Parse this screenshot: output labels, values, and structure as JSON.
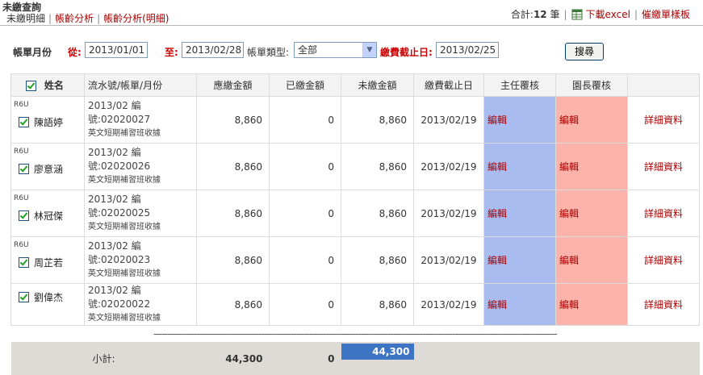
{
  "header": {
    "title": "未繳查詢",
    "nav": [
      "未繳明細",
      "帳齡分析",
      "帳齡分析(明細)"
    ],
    "total_prefix": "合計:",
    "total_count": "12",
    "total_suffix": "筆",
    "download_excel": "下載excel",
    "collection_sample": "催繳單樣板"
  },
  "filter": {
    "label": "帳單月份",
    "from_label": "從:",
    "from_value": "2013/01/01",
    "to_label": "至:",
    "to_value": "2013/02/28",
    "type_label": "帳單類型:",
    "type_value": "全部",
    "deadline_label": "繳費截止日:",
    "deadline_value": "2013/02/25",
    "search_button": "搜尋"
  },
  "table": {
    "headers": [
      "姓名",
      "流水號/帳單/月份",
      "應繳金額",
      "已繳金額",
      "未繳金額",
      "繳費截止日",
      "主任覆核",
      "園長覆核",
      ""
    ],
    "rows": [
      {
        "code": "R6U",
        "name": "陳語婷",
        "line1": "2013/02 編號:02020027",
        "line2": "英文短期補習班收據",
        "due": "8,860",
        "paid": "0",
        "unpaid": "8,860",
        "deadline": "2013/02/19",
        "edit1": "編輯",
        "edit2": "編輯",
        "detail": "詳細資料"
      },
      {
        "code": "R6U",
        "name": "廖意涵",
        "line1": "2013/02 編號:02020026",
        "line2": "英文短期補習班收據",
        "due": "8,860",
        "paid": "0",
        "unpaid": "8,860",
        "deadline": "2013/02/19",
        "edit1": "編輯",
        "edit2": "編輯",
        "detail": "詳細資料"
      },
      {
        "code": "R6U",
        "name": "林冠傑",
        "line1": "2013/02 編號:02020025",
        "line2": "英文短期補習班收據",
        "due": "8,860",
        "paid": "0",
        "unpaid": "8,860",
        "deadline": "2013/02/19",
        "edit1": "編輯",
        "edit2": "編輯",
        "detail": "詳細資料"
      },
      {
        "code": "R6U",
        "name": "周芷若",
        "line1": "2013/02 編號:02020023",
        "line2": "英文短期補習班收據",
        "due": "8,860",
        "paid": "0",
        "unpaid": "8,860",
        "deadline": "2013/02/19",
        "edit1": "編輯",
        "edit2": "編輯",
        "detail": "詳細資料"
      },
      {
        "code": "",
        "name": "劉偉杰",
        "line1": "2013/02 編號:02020022",
        "line2": "英文短期補習班收據",
        "due": "8,860",
        "paid": "0",
        "unpaid": "8,860",
        "deadline": "2013/02/19",
        "edit1": "編輯",
        "edit2": "編輯",
        "detail": "詳細資料"
      }
    ],
    "dashes": "------------------------------------------------------------------------------------------------------------------------------------------------------",
    "subtotal_label": "小計:",
    "subtotal_due": "44,300",
    "subtotal_paid": "0",
    "subtotal_unpaid": "44,300"
  },
  "colors": {
    "director_review": "#a9bcef",
    "principal_review": "#fbb3aa",
    "link": "#aa0000",
    "subtotal_highlight": "#3e74c4"
  },
  "icons": [
    "excel-icon",
    "checkbox-checked-icon",
    "dropdown-arrow-icon"
  ]
}
